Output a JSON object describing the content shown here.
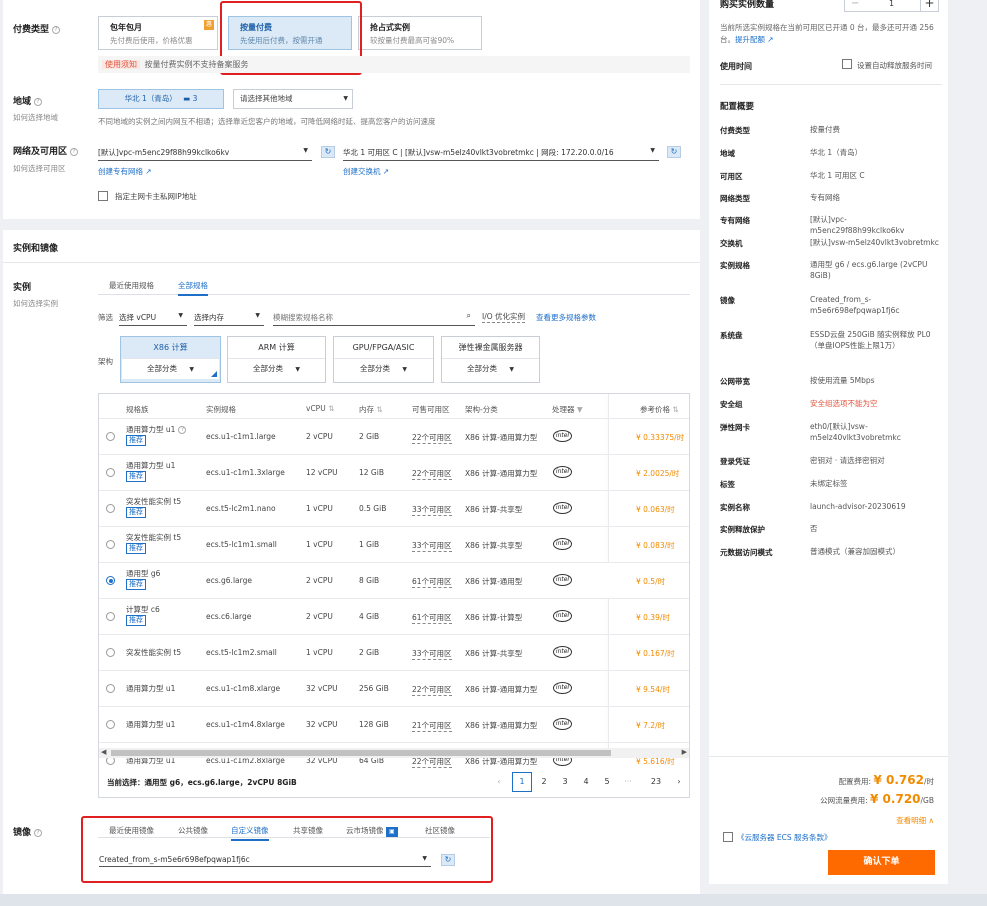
{
  "billing": {
    "label": "付费类型",
    "options": [
      {
        "title": "包年包月",
        "desc": "先付费后使用，价格优惠"
      },
      {
        "title": "按量付费",
        "desc": "先使用后付费，按需开通"
      },
      {
        "title": "抢占式实例",
        "desc": "较按量付费最高可省90%"
      }
    ],
    "note_tag": "使用须知",
    "note_text": "按量付费实例不支持备案服务"
  },
  "region": {
    "label": "地域",
    "help": "如何选择地域",
    "selected": "华北 1（青岛）",
    "badge": "3",
    "other_placeholder": "请选择其他地域",
    "note": "不同地域的实例之间内网互不相通；选择靠近您客户的地域，可降低网络时延、提高您客户的访问速度"
  },
  "network": {
    "label": "网络及可用区",
    "help": "如何选择可用区",
    "vpc": "[默认]vpc-m5enc29f88h99kclko6kv",
    "vswitch": "华北 1 可用区 C | [默认]vsw-m5elz40vlkt3vobretmkc | 网段: 172.20.0.0/16",
    "create_vpc": "创建专有网络",
    "create_vswitch": "创建交换机",
    "specify_ip": "指定主网卡主私网IP地址"
  },
  "instance_section": {
    "title": "实例和镜像",
    "label": "实例",
    "help": "如何选择实例",
    "tabs": [
      "最近使用规格",
      "全部规格"
    ],
    "filter_label": "筛选",
    "vcpu_select": "选择 vCPU",
    "mem_select": "选择内存",
    "search_placeholder": "模糊搜索规格名称",
    "io_opt": "I/O 优化实例",
    "more_params": "查看更多规格参数",
    "arch_label": "架构",
    "archs": [
      {
        "name": "X86 计算",
        "cat": "全部分类"
      },
      {
        "name": "ARM 计算",
        "cat": "全部分类"
      },
      {
        "name": "GPU/FPGA/ASIC",
        "cat": "全部分类"
      },
      {
        "name": "弹性裸金属服务器",
        "cat": "全部分类"
      }
    ],
    "columns": [
      "规格族",
      "实例规格",
      "vCPU",
      "内存",
      "可售可用区",
      "架构-分类",
      "处理器",
      "参考价格"
    ],
    "recommend": "推荐",
    "rows": [
      {
        "family": "通用算力型 u1",
        "spec": "ecs.u1-c1m1.large",
        "vcpu": "2 vCPU",
        "mem": "2 GiB",
        "zones": "22个可用区",
        "arch": "X86 计算-通用算力型",
        "price": "¥ 0.33375/时",
        "rec": true,
        "selected": false
      },
      {
        "family": "通用算力型 u1",
        "spec": "ecs.u1-c1m1.3xlarge",
        "vcpu": "12 vCPU",
        "mem": "12 GiB",
        "zones": "22个可用区",
        "arch": "X86 计算-通用算力型",
        "price": "¥ 2.0025/时",
        "rec": true,
        "selected": false
      },
      {
        "family": "突发性能实例 t5",
        "spec": "ecs.t5-lc2m1.nano",
        "vcpu": "1 vCPU",
        "mem": "0.5 GiB",
        "zones": "33个可用区",
        "arch": "X86 计算-共享型",
        "price": "¥ 0.063/时",
        "rec": true,
        "selected": false
      },
      {
        "family": "突发性能实例 t5",
        "spec": "ecs.t5-lc1m1.small",
        "vcpu": "1 vCPU",
        "mem": "1 GiB",
        "zones": "33个可用区",
        "arch": "X86 计算-共享型",
        "price": "¥ 0.083/时",
        "rec": true,
        "selected": false
      },
      {
        "family": "通用型 g6",
        "spec": "ecs.g6.large",
        "vcpu": "2 vCPU",
        "mem": "8 GiB",
        "zones": "61个可用区",
        "arch": "X86 计算-通用型",
        "price": "¥ 0.5/时",
        "rec": true,
        "selected": true
      },
      {
        "family": "计算型 c6",
        "spec": "ecs.c6.large",
        "vcpu": "2 vCPU",
        "mem": "4 GiB",
        "zones": "61个可用区",
        "arch": "X86 计算-计算型",
        "price": "¥ 0.39/时",
        "rec": true,
        "selected": false
      },
      {
        "family": "突发性能实例 t5",
        "spec": "ecs.t5-lc1m2.small",
        "vcpu": "1 vCPU",
        "mem": "2 GiB",
        "zones": "33个可用区",
        "arch": "X86 计算-共享型",
        "price": "¥ 0.167/时",
        "rec": false,
        "selected": false
      },
      {
        "family": "通用算力型 u1",
        "spec": "ecs.u1-c1m8.xlarge",
        "vcpu": "32 vCPU",
        "mem": "256 GiB",
        "zones": "22个可用区",
        "arch": "X86 计算-通用算力型",
        "price": "¥ 9.54/时",
        "rec": false,
        "selected": false
      },
      {
        "family": "通用算力型 u1",
        "spec": "ecs.u1-c1m4.8xlarge",
        "vcpu": "32 vCPU",
        "mem": "128 GiB",
        "zones": "21个可用区",
        "arch": "X86 计算-通用算力型",
        "price": "¥ 7.2/时",
        "rec": false,
        "selected": false
      },
      {
        "family": "通用算力型 u1",
        "spec": "ecs.u1-c1m2.8xlarge",
        "vcpu": "32 vCPU",
        "mem": "64 GiB",
        "zones": "22个可用区",
        "arch": "X86 计算-通用算力型",
        "price": "¥ 5.616/时",
        "rec": false,
        "selected": false
      }
    ],
    "current_label": "当前选择：",
    "current_value": "通用型 g6，ecs.g6.large，2vCPU 8GiB",
    "pages": [
      "1",
      "2",
      "3",
      "4",
      "5",
      "···",
      "23"
    ]
  },
  "image": {
    "label": "镜像",
    "tabs": [
      "最近使用镜像",
      "公共镜像",
      "自定义镜像",
      "共享镜像",
      "云市场镜像",
      "社区镜像"
    ],
    "selected": "Created_from_s-m5e6r698efpqwap1fj6c"
  },
  "summary": {
    "buy_qty_label": "购买实例数量",
    "qty": "1",
    "quota_text": "当前所选实例规格在当前可用区已开通 0 台，最多还可开通 256 台。",
    "quota_link": "提升配额",
    "duration_label": "使用时间",
    "auto_release": "设置自动释放服务时间",
    "overview_title": "配置概要",
    "items": [
      {
        "k": "付费类型",
        "v": "按量付费"
      },
      {
        "k": "地域",
        "v": "华北 1（青岛）"
      },
      {
        "k": "可用区",
        "v": "华北 1 可用区 C"
      },
      {
        "k": "网络类型",
        "v": "专有网络"
      },
      {
        "k": "专有网络",
        "v": "[默认]vpc-m5enc29f88h99kclko6kv"
      },
      {
        "k": "交换机",
        "v": "[默认]vsw-m5elz40vlkt3vobretmkc"
      },
      {
        "k": "实例规格",
        "v": "通用型 g6 / ecs.g6.large (2vCPU 8GiB)"
      },
      {
        "k": "镜像",
        "v": "Created_from_s-m5e6r698efpqwap1fj6c"
      },
      {
        "k": "系统盘",
        "v": "ESSD云盘 250GiB 随实例释放 PL0（单盘IOPS性能上限1万）"
      },
      {
        "k": "公网带宽",
        "v": "按使用流量 5Mbps"
      },
      {
        "k": "安全组",
        "v": "安全组选项不能为空"
      },
      {
        "k": "弹性网卡",
        "v": "eth0/[默认]vsw-m5elz40vlkt3vobretmkc"
      },
      {
        "k": "登录凭证",
        "v": "密钥对 · 请选择密钥对"
      },
      {
        "k": "标签",
        "v": "未绑定标签"
      },
      {
        "k": "实例名称",
        "v": "launch-advisor-20230619"
      },
      {
        "k": "实例释放保护",
        "v": "否"
      },
      {
        "k": "元数据访问模式",
        "v": "普通模式（兼容加固模式）"
      }
    ],
    "config_fee_label": "配置费用:",
    "config_fee": "¥ 0.762",
    "config_fee_unit": "/时",
    "traffic_fee_label": "公网流量费用:",
    "traffic_fee": "¥ 0.720",
    "traffic_fee_unit": "/GB",
    "detail_link": "查看明细",
    "terms": "《云服务器 ECS 服务条款》",
    "submit": "确认下单"
  },
  "colors": {
    "accent": "#1d6fc8",
    "price": "#f08a00",
    "submit": "#ff6a00",
    "highlight": "#e02020"
  }
}
